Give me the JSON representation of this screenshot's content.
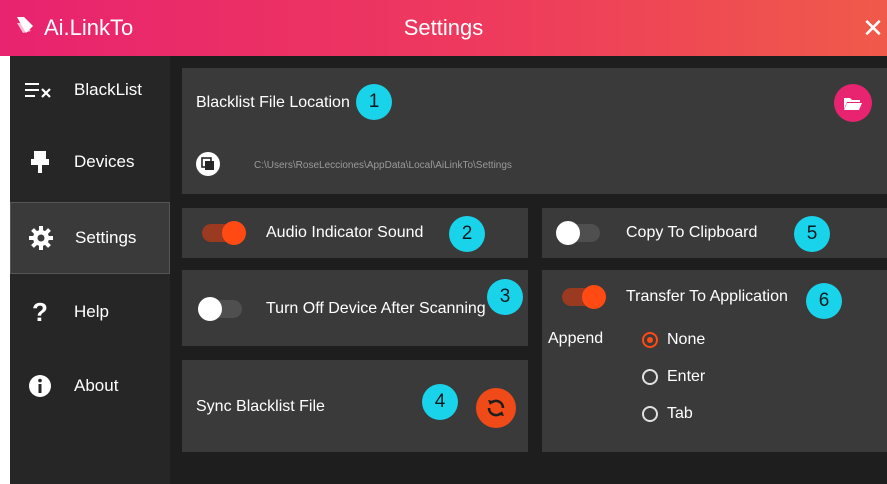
{
  "titlebar": {
    "app_name": "Ai.LinkTo",
    "window_title": "Settings",
    "close_icon": "close-icon",
    "accent": "#e8236f"
  },
  "sidebar": {
    "items": [
      {
        "label": "BlackList",
        "icon": "blacklist-icon"
      },
      {
        "label": "Devices",
        "icon": "device-icon"
      },
      {
        "label": "Settings",
        "icon": "gear-icon",
        "active": true
      },
      {
        "label": "Help",
        "icon": "question-icon"
      },
      {
        "label": "About",
        "icon": "info-icon"
      }
    ]
  },
  "settings": {
    "blacklist_location": {
      "label": "Blacklist File Location",
      "badge": "1",
      "path": "C:\\Users\\RoseLecciones\\AppData\\Local\\AiLinkTo\\Settings",
      "folder_icon": "folder-open-icon",
      "browse_icon": "copy-icon"
    },
    "audio_indicator": {
      "label": "Audio Indicator Sound",
      "badge": "2",
      "enabled": true
    },
    "turn_off_device": {
      "label": "Turn Off Device After Scanning",
      "badge": "3",
      "enabled": false
    },
    "sync_blacklist": {
      "label": "Sync Blacklist File",
      "badge": "4",
      "icon": "sync-icon"
    },
    "copy_clipboard": {
      "label": "Copy To Clipboard",
      "badge": "5",
      "enabled": false
    },
    "transfer_app": {
      "label": "Transfer To Application",
      "badge": "6",
      "enabled": true,
      "append_label": "Append",
      "options": [
        "None",
        "Enter",
        "Tab"
      ],
      "selected": "None"
    }
  },
  "colors": {
    "toggle_on": "#ff4a14",
    "badge": "#19d3ea",
    "panel": "#3a3a3a",
    "background": "#262626"
  }
}
